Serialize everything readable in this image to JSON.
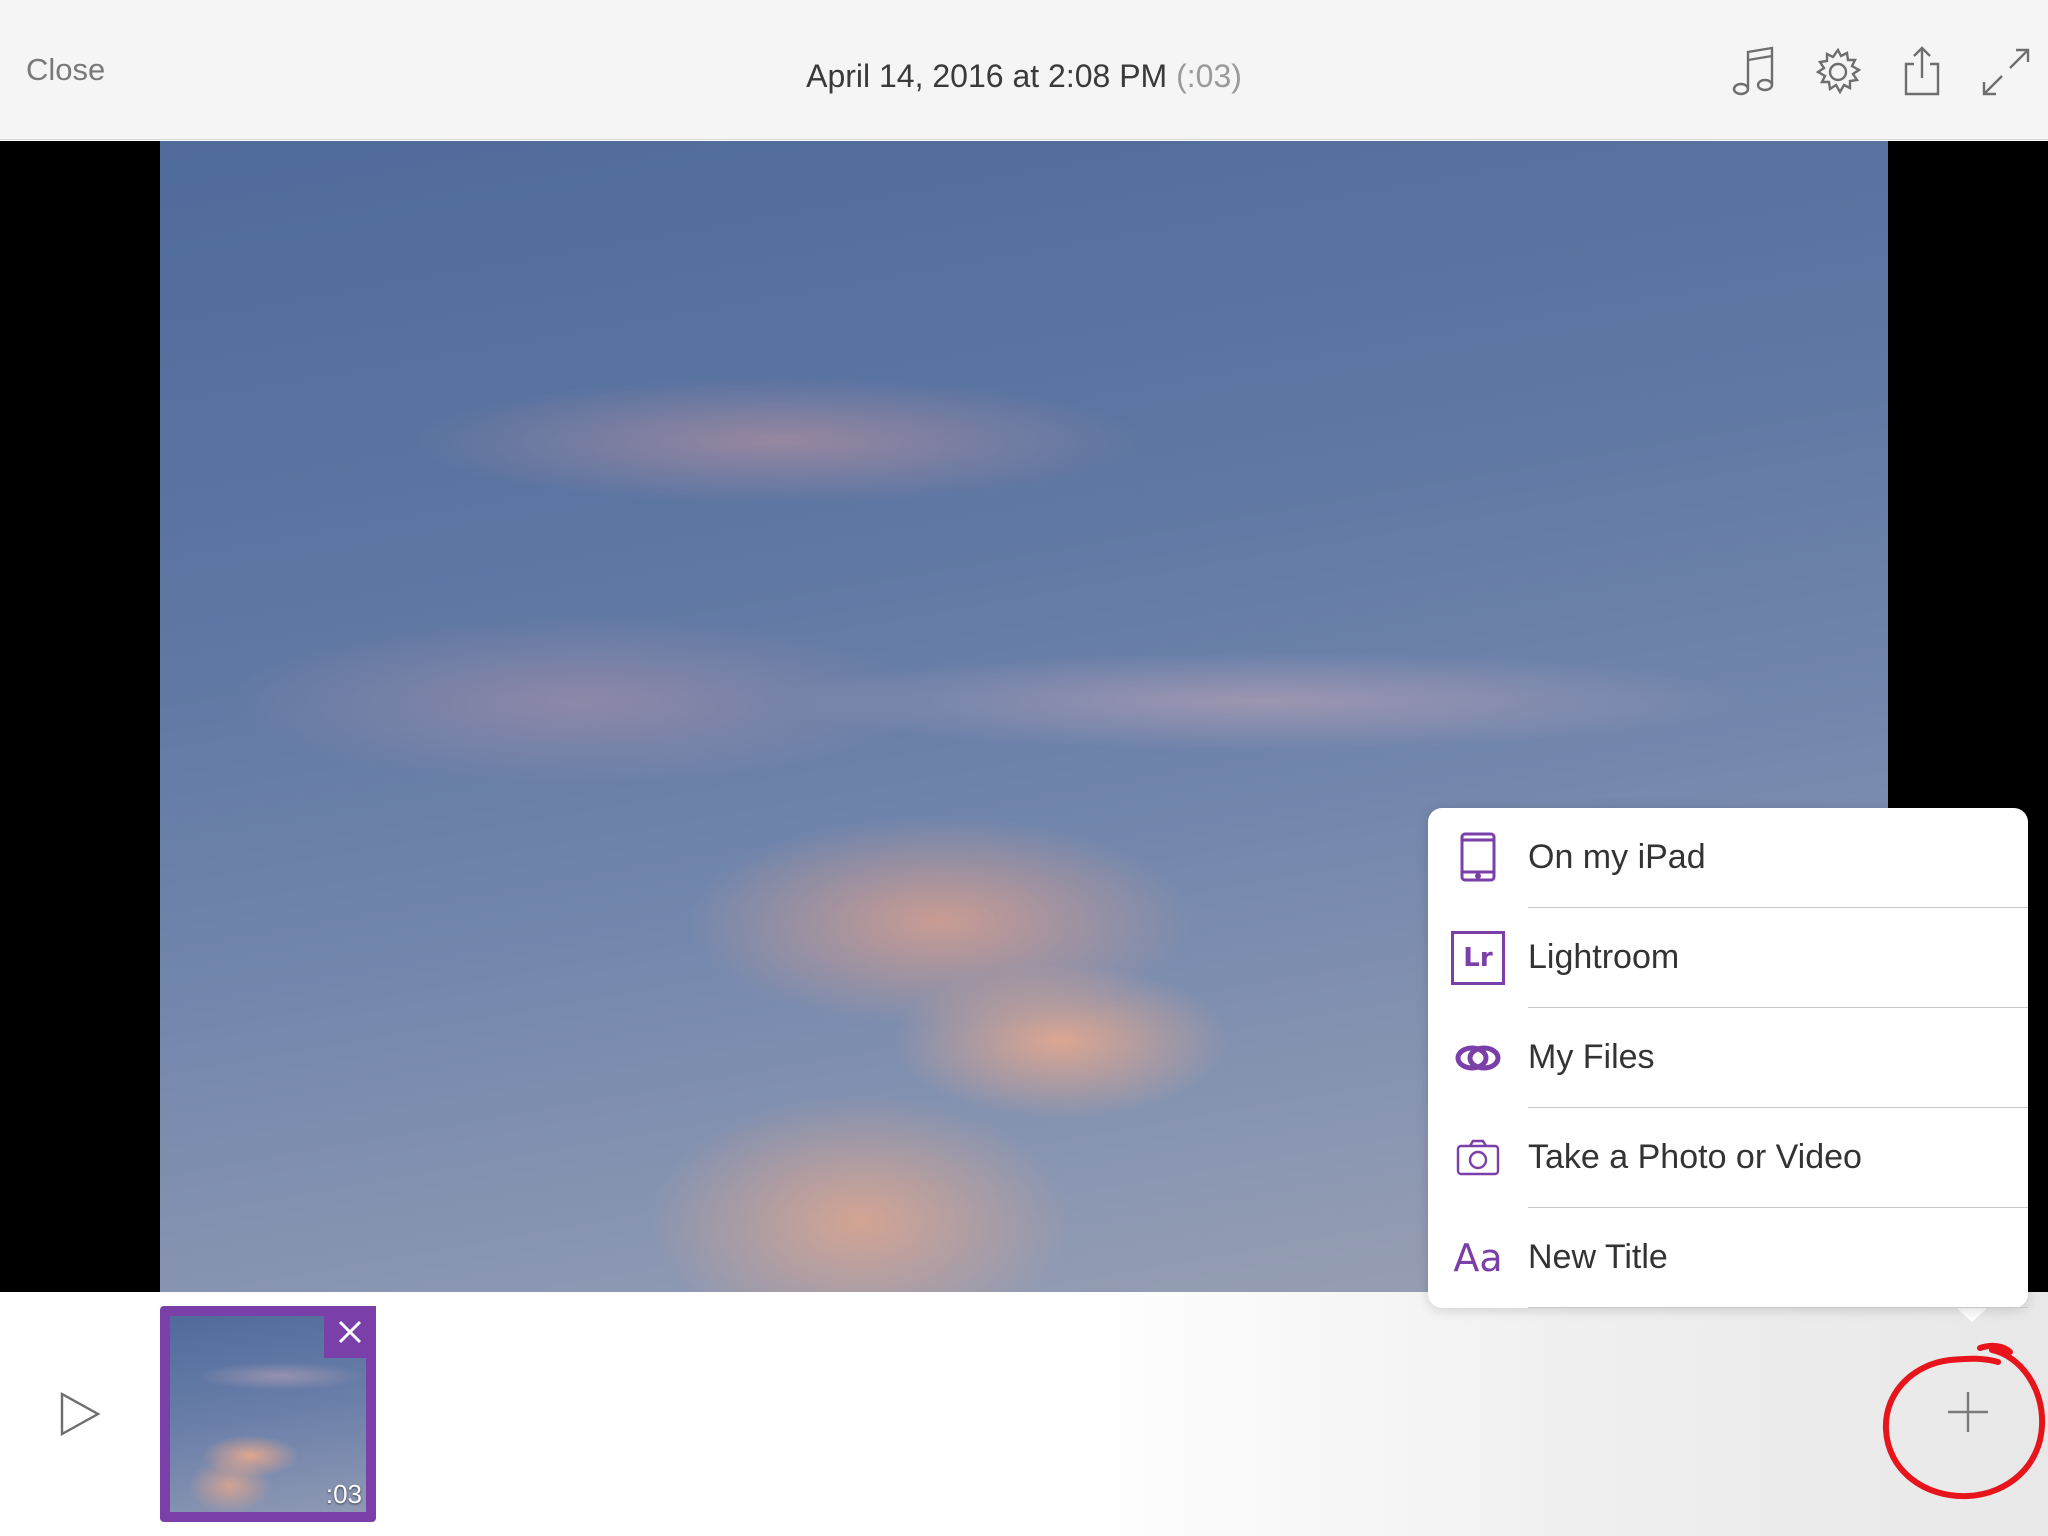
{
  "header": {
    "close_label": "Close",
    "title": "April 14, 2016 at 2:08 PM",
    "duration": "(:03)",
    "icons": [
      "music-icon",
      "gear-icon",
      "share-icon",
      "fullscreen-icon"
    ]
  },
  "add_menu": {
    "items": [
      {
        "label": "On my iPad",
        "icon": "ipad-icon"
      },
      {
        "label": "Lightroom",
        "icon": "lightroom-icon",
        "icon_text": "Lr"
      },
      {
        "label": "My Files",
        "icon": "creative-cloud-icon"
      },
      {
        "label": "Take a Photo or Video",
        "icon": "camera-icon"
      },
      {
        "label": "New Title",
        "icon": "type-icon",
        "icon_text": "Aa"
      }
    ]
  },
  "timeline": {
    "clips": [
      {
        "duration": ":03"
      }
    ]
  },
  "colors": {
    "accent": "#7a3fa8",
    "annotation": "#e8141c",
    "topbar_bg": "#f5f5f5",
    "text": "#333333"
  }
}
